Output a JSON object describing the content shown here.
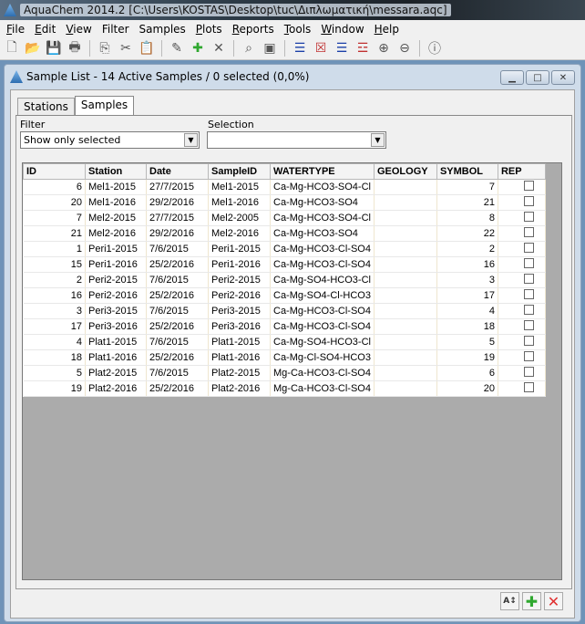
{
  "app": {
    "title": "AquaChem 2014.2 [C:\\Users\\KOSTAS\\Desktop\\tuc\\Διπλωματική\\messara.aqc]"
  },
  "menu": [
    "File",
    "Edit",
    "View",
    "Filter",
    "Samples",
    "Plots",
    "Reports",
    "Tools",
    "Window",
    "Help"
  ],
  "toolbar_icons": [
    "new-icon",
    "open-icon",
    "save-icon",
    "print-icon",
    "copy-icon",
    "cut-icon",
    "paste-icon",
    "edit-icon",
    "add-icon",
    "delete-icon",
    "find-icon",
    "export-icon",
    "list-icon",
    "list-delete-icon",
    "list-select-icon",
    "list-clear-icon",
    "zoom-in-icon",
    "zoom-out-icon",
    "info-icon"
  ],
  "window": {
    "title": "Sample List - 14 Active Samples / 0 selected (0,0%)"
  },
  "tabs": [
    "Stations",
    "Samples"
  ],
  "active_tab": "Samples",
  "filter": {
    "label": "Filter",
    "value": "Show only selected"
  },
  "selection": {
    "label": "Selection",
    "value": ""
  },
  "table": {
    "columns": [
      "ID",
      "Station",
      "Date",
      "SampleID",
      "WATERTYPE",
      "GEOLOGY",
      "SYMBOL",
      "REP"
    ],
    "rows": [
      [
        "6",
        "Mel1-2015",
        "27/7/2015",
        "Mel1-2015",
        "Ca-Mg-HCO3-SO4-Cl",
        "",
        "7"
      ],
      [
        "20",
        "Mel1-2016",
        "29/2/2016",
        "Mel1-2016",
        "Ca-Mg-HCO3-SO4",
        "",
        "21"
      ],
      [
        "7",
        "Mel2-2015",
        "27/7/2015",
        "Mel2-2005",
        "Ca-Mg-HCO3-SO4-Cl",
        "",
        "8"
      ],
      [
        "21",
        "Mel2-2016",
        "29/2/2016",
        "Mel2-2016",
        "Ca-Mg-HCO3-SO4",
        "",
        "22"
      ],
      [
        "1",
        "Peri1-2015",
        "7/6/2015",
        "Peri1-2015",
        "Ca-Mg-HCO3-Cl-SO4",
        "",
        "2"
      ],
      [
        "15",
        "Peri1-2016",
        "25/2/2016",
        "Peri1-2016",
        "Ca-Mg-HCO3-Cl-SO4",
        "",
        "16"
      ],
      [
        "2",
        "Peri2-2015",
        "7/6/2015",
        "Peri2-2015",
        "Ca-Mg-SO4-HCO3-Cl",
        "",
        "3"
      ],
      [
        "16",
        "Peri2-2016",
        "25/2/2016",
        "Peri2-2016",
        "Ca-Mg-SO4-Cl-HCO3",
        "",
        "17"
      ],
      [
        "3",
        "Peri3-2015",
        "7/6/2015",
        "Peri3-2015",
        "Ca-Mg-HCO3-Cl-SO4",
        "",
        "4"
      ],
      [
        "17",
        "Peri3-2016",
        "25/2/2016",
        "Peri3-2016",
        "Ca-Mg-HCO3-Cl-SO4",
        "",
        "18"
      ],
      [
        "4",
        "Plat1-2015",
        "7/6/2015",
        "Plat1-2015",
        "Ca-Mg-SO4-HCO3-Cl",
        "",
        "5"
      ],
      [
        "18",
        "Plat1-2016",
        "25/2/2016",
        "Plat1-2016",
        "Ca-Mg-Cl-SO4-HCO3",
        "",
        "19"
      ],
      [
        "5",
        "Plat2-2015",
        "7/6/2015",
        "Plat2-2015",
        "Mg-Ca-HCO3-Cl-SO4",
        "",
        "6"
      ],
      [
        "19",
        "Plat2-2016",
        "25/2/2016",
        "Plat2-2016",
        "Mg-Ca-HCO3-Cl-SO4",
        "",
        "20"
      ]
    ]
  },
  "bottom_buttons": [
    "sort-icon",
    "add-icon",
    "delete-icon"
  ],
  "colors": {
    "add": "#2fa82f",
    "delete": "#e03030"
  }
}
